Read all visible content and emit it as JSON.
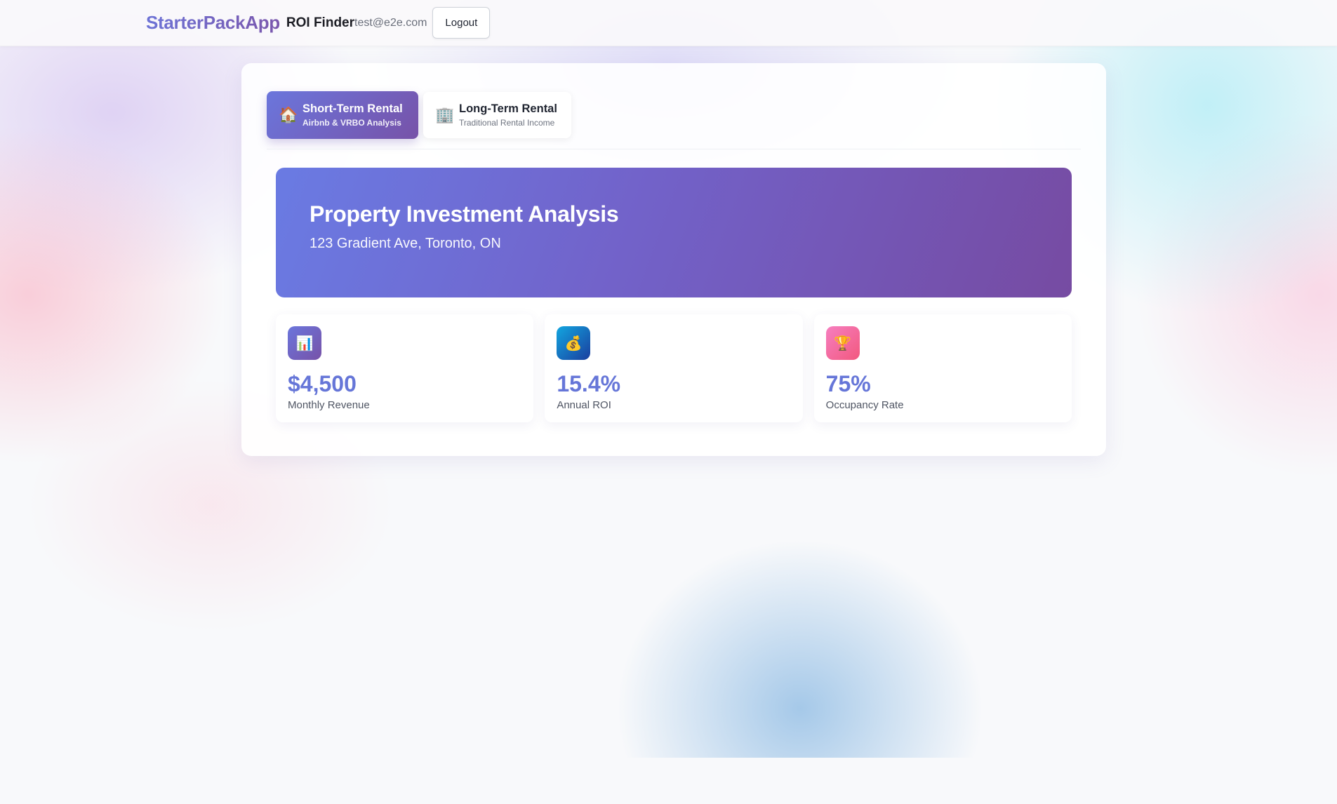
{
  "header": {
    "brand": "StarterPackApp",
    "page_name": "ROI Finder",
    "user_email": "test@e2e.com",
    "logout_label": "Logout"
  },
  "tabs": [
    {
      "icon": "house-icon",
      "glyph": "🏠",
      "title": "Short-Term Rental",
      "subtitle": "Airbnb & VRBO Analysis",
      "active": true
    },
    {
      "icon": "office-building-icon",
      "glyph": "🏢",
      "title": "Long-Term Rental",
      "subtitle": "Traditional Rental Income",
      "active": false
    }
  ],
  "hero": {
    "title": "Property Investment Analysis",
    "address": "123 Gradient Ave, Toronto, ON"
  },
  "metrics": [
    {
      "icon": "bar-chart-icon",
      "glyph": "📊",
      "value": "$4,500",
      "label": "Monthly Revenue"
    },
    {
      "icon": "money-bag-icon",
      "glyph": "💰",
      "value": "15.4%",
      "label": "Annual ROI"
    },
    {
      "icon": "trophy-icon",
      "glyph": "🏆",
      "value": "75%",
      "label": "Occupancy Rate"
    }
  ],
  "colors": {
    "accent": "#6676d8",
    "gradient_start": "#667eea",
    "gradient_end": "#764ba2"
  }
}
